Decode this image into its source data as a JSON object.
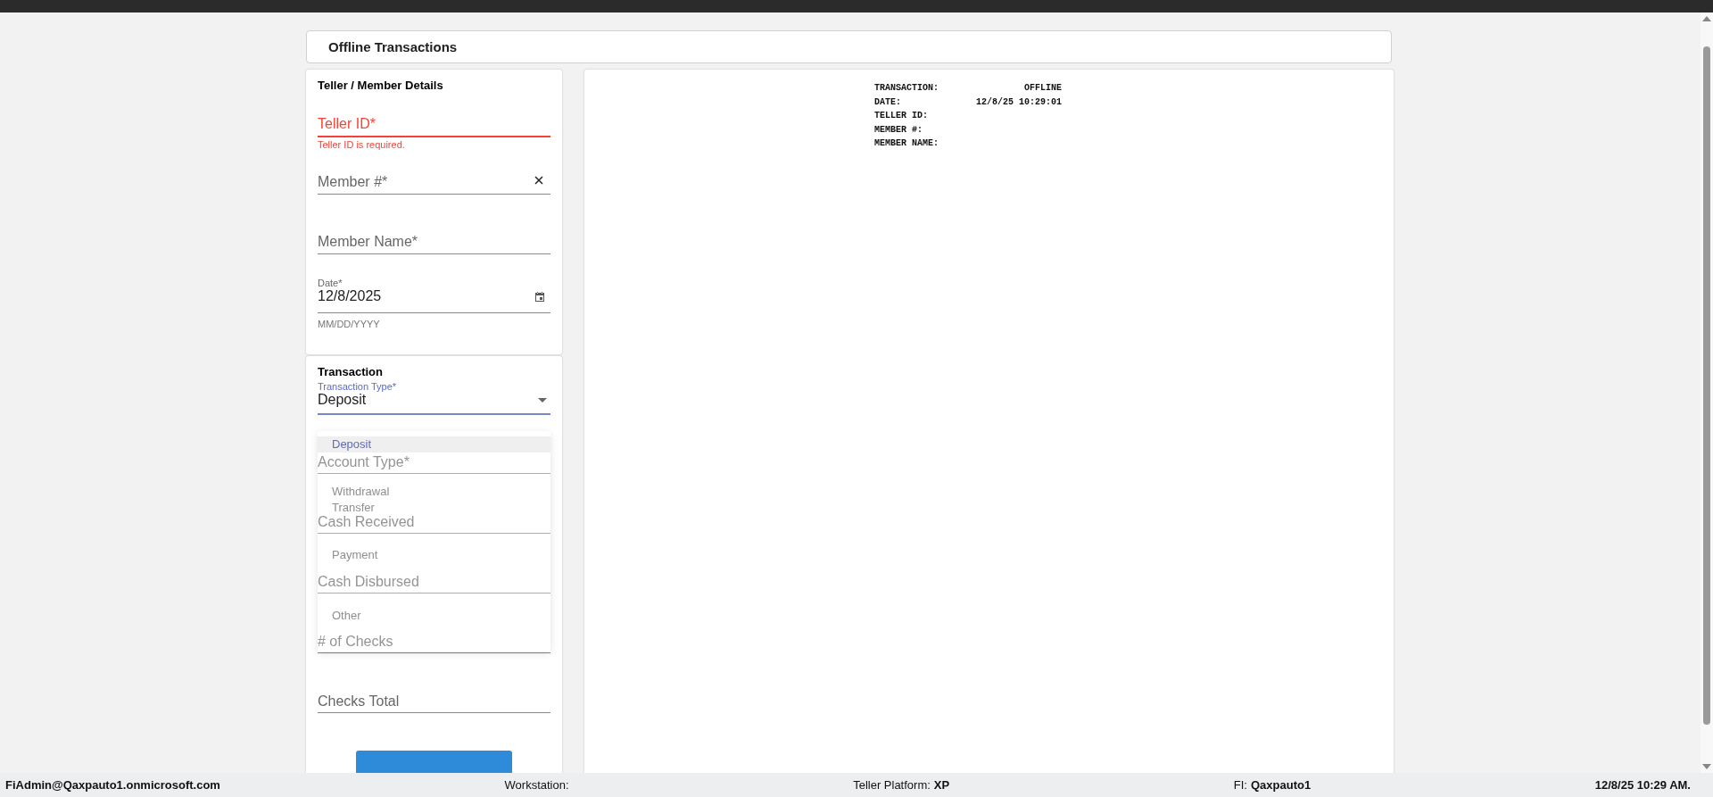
{
  "page_title": "Offline Transactions",
  "details": {
    "title": "Teller / Member Details",
    "fields": [
      {
        "kind": "text",
        "label": "Teller ID*",
        "error": true,
        "error_text": "Teller ID is required."
      },
      {
        "kind": "clearable",
        "label": "Member #*",
        "error": false
      },
      {
        "kind": "text",
        "label": "Member Name*",
        "error": false
      },
      {
        "kind": "date",
        "label": "Date*",
        "value": "12/8/2025",
        "helper": "MM/DD/YYYY",
        "error": false
      }
    ]
  },
  "transaction": {
    "title": "Transaction",
    "type_field": {
      "label": "Transaction Type*",
      "value": "Deposit",
      "focused": true
    },
    "fields": [
      {
        "label": "Account Type*"
      },
      {
        "label": "Cash Received"
      },
      {
        "label": "Cash Disbursed"
      },
      {
        "label": "# of Checks"
      },
      {
        "label": "Checks Total"
      }
    ],
    "menu": [
      {
        "label": "Deposit",
        "selected": true
      },
      {
        "label": "Withdrawal",
        "selected": false
      },
      {
        "label": "Transfer",
        "selected": false
      },
      {
        "label": "Payment",
        "selected": false
      },
      {
        "label": "Other",
        "selected": false
      }
    ]
  },
  "receipt": [
    {
      "label": "TRANSACTION:",
      "value": "OFFLINE"
    },
    {
      "label": "DATE:",
      "value": "12/8/25 10:29:01"
    },
    {
      "label": "TELLER ID:"
    },
    {
      "label": "MEMBER #:"
    },
    {
      "label": "MEMBER NAME:"
    }
  ],
  "status_bar": [
    {
      "label": "FiAdmin@Qaxpauto1.onmicrosoft.com",
      "kind": "bold"
    },
    {
      "label": "Workstation:",
      "kind": "pair"
    },
    {
      "label": "Teller Platform:",
      "value": "XP",
      "kind": "pair"
    },
    {
      "label": "FI:",
      "value": "Qaxpauto1",
      "kind": "pair"
    },
    {
      "label": "12/8/25 10:29 AM.",
      "kind": "bold"
    }
  ]
}
